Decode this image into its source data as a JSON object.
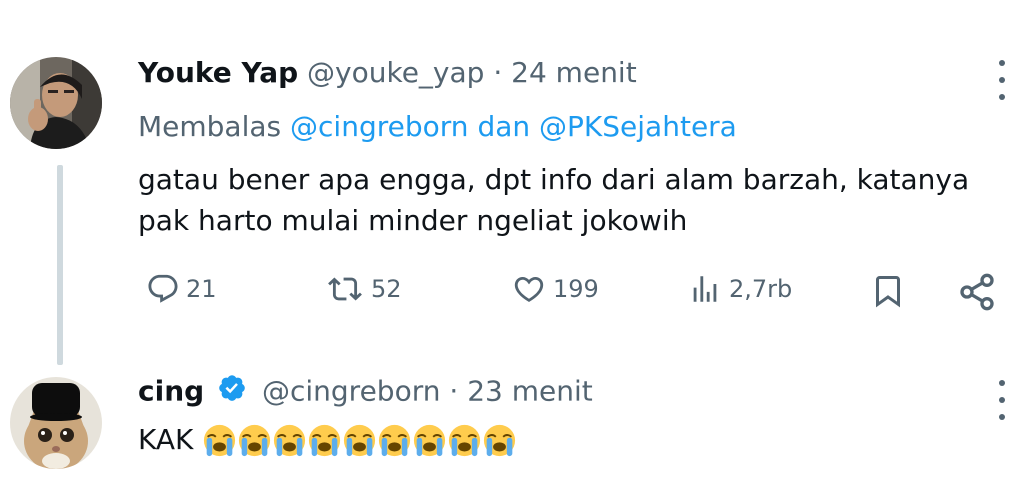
{
  "tweet1": {
    "name": "Youke Yap",
    "handle": "@youke_yap",
    "separator": "·",
    "time": "24 menit",
    "reply_prefix": "Membalas",
    "reply_user1": "@cingreborn",
    "reply_conj": "dan",
    "reply_user2": "@PKSejahtera",
    "text_line1": "gatau bener apa engga, dpt info dari alam barzah, katanya",
    "text_line2": "pak harto mulai minder ngeliat jokowih",
    "replies": "21",
    "retweets": "52",
    "likes": "199",
    "views": "2,7rb"
  },
  "tweet2": {
    "name": "cing",
    "handle": "@cingreborn",
    "separator": "·",
    "time": "23 menit",
    "text": "KAK",
    "emoji_count": 9,
    "emoji_name": "loudly-crying-face"
  },
  "colors": {
    "text": "#0f1419",
    "muted": "#536471",
    "link": "#1d9bf0",
    "verified": "#1d9bf0"
  }
}
